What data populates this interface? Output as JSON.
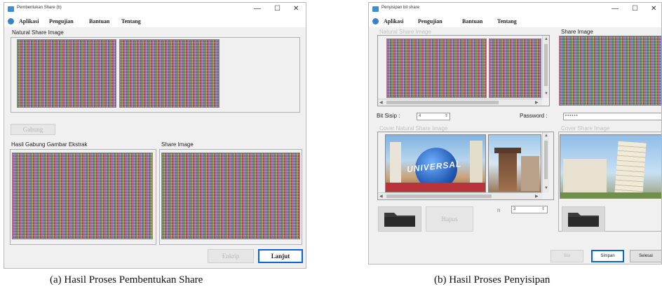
{
  "window_a": {
    "title": "Pembentukan Share (b)",
    "controls": {
      "minimize": "—",
      "maximize": "☐",
      "close": "✕"
    },
    "menu": [
      "Aplikasi",
      "Pengujian",
      "Bantuan",
      "Tentang"
    ],
    "natural_share_label": "Natural Share Image",
    "gabung_button": "Gabung",
    "hasil_gabung_label": "Hasil Gabung Gambar Ekstrak",
    "share_image_label": "Share Image",
    "enkrip_button": "Enkrip",
    "lanjut_button": "Lanjut"
  },
  "window_b": {
    "title": "Penyisipan bit share",
    "controls": {
      "minimize": "—",
      "maximize": "☐",
      "close": "✕"
    },
    "menu": [
      "Aplikasi",
      "Pengujian",
      "Bantuan",
      "Tentang"
    ],
    "natural_share_label": "Natural Share Image",
    "share_image_label": "Share Image",
    "bit_sisip_label": "Bit Sisip :",
    "bit_sisip_value": "4",
    "password_label": "Password :",
    "password_value": "••••••",
    "cover_natural_label": "Cover Natural Share  Image",
    "cover_share_label": "Cover Share Image",
    "universal_text": "UNIVERSAL",
    "hapus_button": "Hapus",
    "n_label": "n",
    "n_value": "3",
    "sisi_button": "Sisi",
    "simpan_button": "Simpan",
    "selesai_button": "Selesai"
  },
  "captions": {
    "a": "(a) Hasil Proses Pembentukan Share",
    "b": "(b) Hasil Proses Penyisipan"
  },
  "colors": {
    "window_bg": "#f0f0f0",
    "focus_blue": "#0a64d6",
    "disabled_text": "#b8b8b8"
  }
}
